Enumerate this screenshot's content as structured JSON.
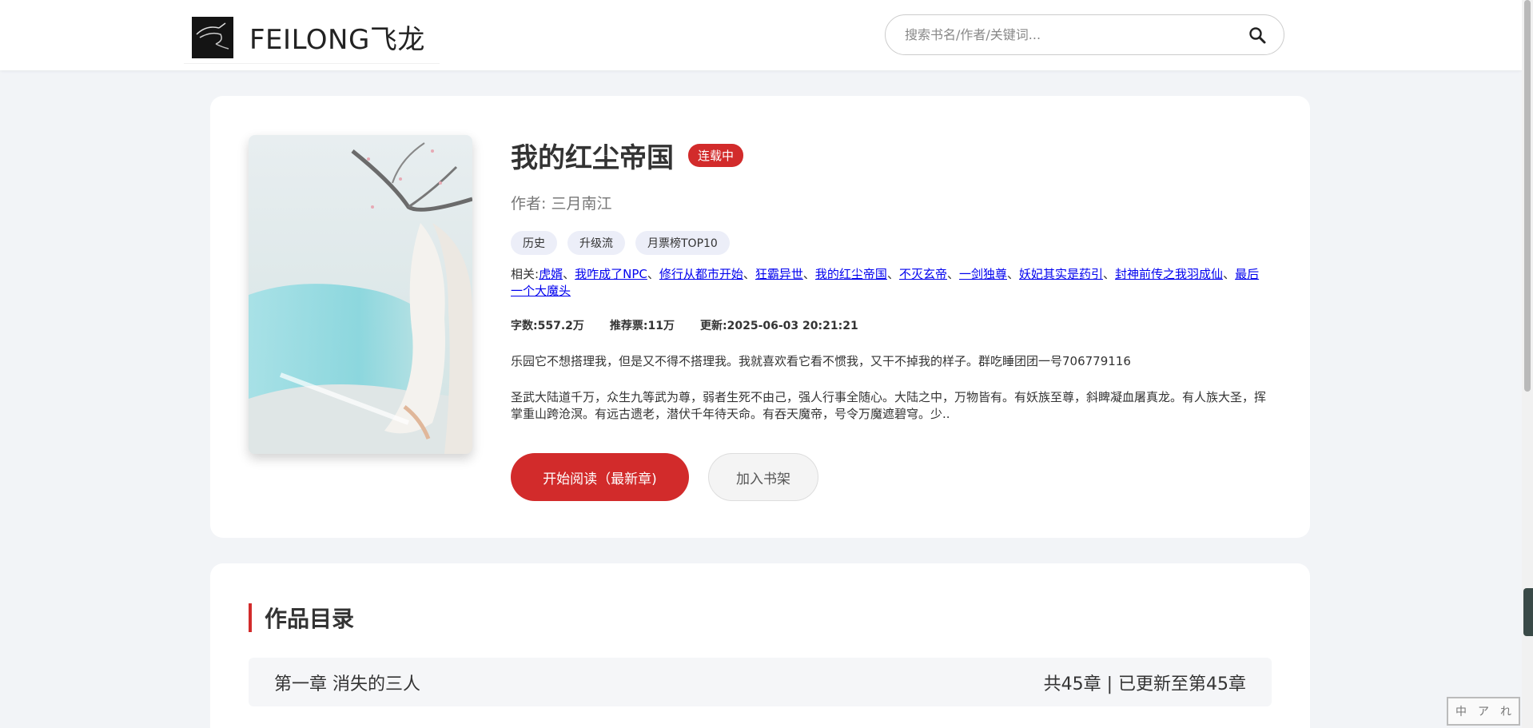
{
  "header": {
    "logo_text": "FEILONG飞龙",
    "search_placeholder": "搜索书名/作者/关键词..."
  },
  "book": {
    "title": "我的红尘帝国",
    "status": "连载中",
    "author_label": "作者:",
    "author": "三月南江",
    "tags": [
      "历史",
      "升级流",
      "月票榜TOP10"
    ],
    "related_label": "相关:",
    "related": [
      "虎婿",
      "我咋成了NPC",
      "修行从都市开始",
      "狂霸异世",
      "我的红尘帝国",
      "不灭玄帝",
      "一剑独尊",
      "妖妃其实是药引",
      "封神前传之我羽成仙",
      "最后一个大魔头"
    ],
    "stats": {
      "words_label": "字数:",
      "words": "557.2万",
      "votes_label": "推荐票:",
      "votes": "11万",
      "updated_label": "更新:",
      "updated": "2025-06-03 20:21:21"
    },
    "desc1": "乐园它不想搭理我，但是又不得不搭理我。我就喜欢看它看不惯我，又干不掉我的样子。群吃睡团团一号706779116",
    "desc2": "圣武大陆道千万，众生九等武为尊，弱者生死不由己，强人行事全随心。大陆之中，万物皆有。有妖族至尊，斜睥凝血屠真龙。有人族大圣，挥掌重山跨沧溟。有远古遗老，潜伏千年待天命。有吞天魔帝，号令万魔遮碧穹。少..",
    "read_button": "开始阅读（最新章)",
    "shelf_button": "加入书架"
  },
  "toc": {
    "title": "作品目录",
    "first_chapter": "第一章 消失的三人",
    "count_text": "共45章 | 已更新至第45章"
  },
  "corner": {
    "chars": [
      "中",
      "ア",
      "れ"
    ]
  },
  "colors": {
    "accent": "#d22b2b",
    "page_bg": "#f2f4f7",
    "tag_bg": "#eceef8",
    "link": "#0000ee"
  }
}
